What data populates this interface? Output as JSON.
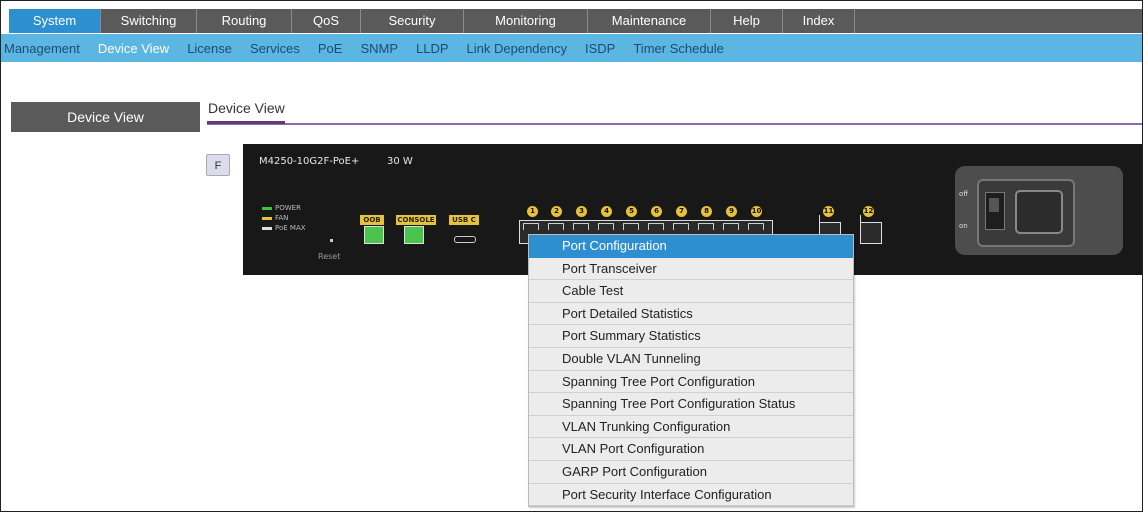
{
  "topnav": {
    "tabs": [
      {
        "label": "System",
        "active": true
      },
      {
        "label": "Switching",
        "active": false
      },
      {
        "label": "Routing",
        "active": false
      },
      {
        "label": "QoS",
        "active": false
      },
      {
        "label": "Security",
        "active": false
      },
      {
        "label": "Monitoring",
        "active": false
      },
      {
        "label": "Maintenance",
        "active": false
      },
      {
        "label": "Help",
        "active": false
      },
      {
        "label": "Index",
        "active": false
      }
    ]
  },
  "subnav": {
    "items": [
      {
        "label": "Management",
        "active": false
      },
      {
        "label": "Device View",
        "active": true
      },
      {
        "label": "License",
        "active": false
      },
      {
        "label": "Services",
        "active": false
      },
      {
        "label": "PoE",
        "active": false
      },
      {
        "label": "SNMP",
        "active": false
      },
      {
        "label": "LLDP",
        "active": false
      },
      {
        "label": "Link Dependency",
        "active": false
      },
      {
        "label": "ISDP",
        "active": false
      },
      {
        "label": "Timer Schedule",
        "active": false
      }
    ]
  },
  "sidebar": {
    "button_label": "Device View"
  },
  "page": {
    "heading": "Device View",
    "f_button": "F"
  },
  "device": {
    "model": "M4250-10G2F-PoE+",
    "power": "30 W",
    "leds": {
      "power": "POWER",
      "fan": "FAN",
      "poe_max": "PoE MAX"
    },
    "reset_label": "Reset",
    "tags": {
      "oob": "OOB",
      "console": "CONSOLE",
      "usbc": "USB C"
    },
    "port_numbers": [
      "1",
      "2",
      "3",
      "4",
      "5",
      "6",
      "7",
      "8",
      "9",
      "10",
      "11",
      "12"
    ],
    "power_labels": {
      "off": "off",
      "on": "on"
    },
    "colors": {
      "led_power": "#3cc43c",
      "led_fan": "#e6c23a",
      "led_poe": "#e0e0e0",
      "tag": "#e6c23a",
      "port_active": "#49c44d"
    }
  },
  "context_menu": {
    "items": [
      {
        "label": "Port Configuration",
        "active": true
      },
      {
        "label": "Port Transceiver",
        "active": false
      },
      {
        "label": "Cable Test",
        "active": false
      },
      {
        "label": "Port Detailed Statistics",
        "active": false
      },
      {
        "label": "Port Summary Statistics",
        "active": false
      },
      {
        "label": "Double VLAN Tunneling",
        "active": false
      },
      {
        "label": "Spanning Tree Port Configuration",
        "active": false
      },
      {
        "label": "Spanning Tree Port Configuration Status",
        "active": false
      },
      {
        "label": "VLAN Trunking Configuration",
        "active": false
      },
      {
        "label": "VLAN Port Configuration",
        "active": false
      },
      {
        "label": "GARP Port Configuration",
        "active": false
      },
      {
        "label": "Port Security Interface Configuration",
        "active": false
      }
    ]
  },
  "colors": {
    "nav_bg": "#5a5a5a",
    "nav_active": "#2d8fd0",
    "subnav_bg": "#5bb6e4",
    "heading_line": "#8f6aa8"
  }
}
